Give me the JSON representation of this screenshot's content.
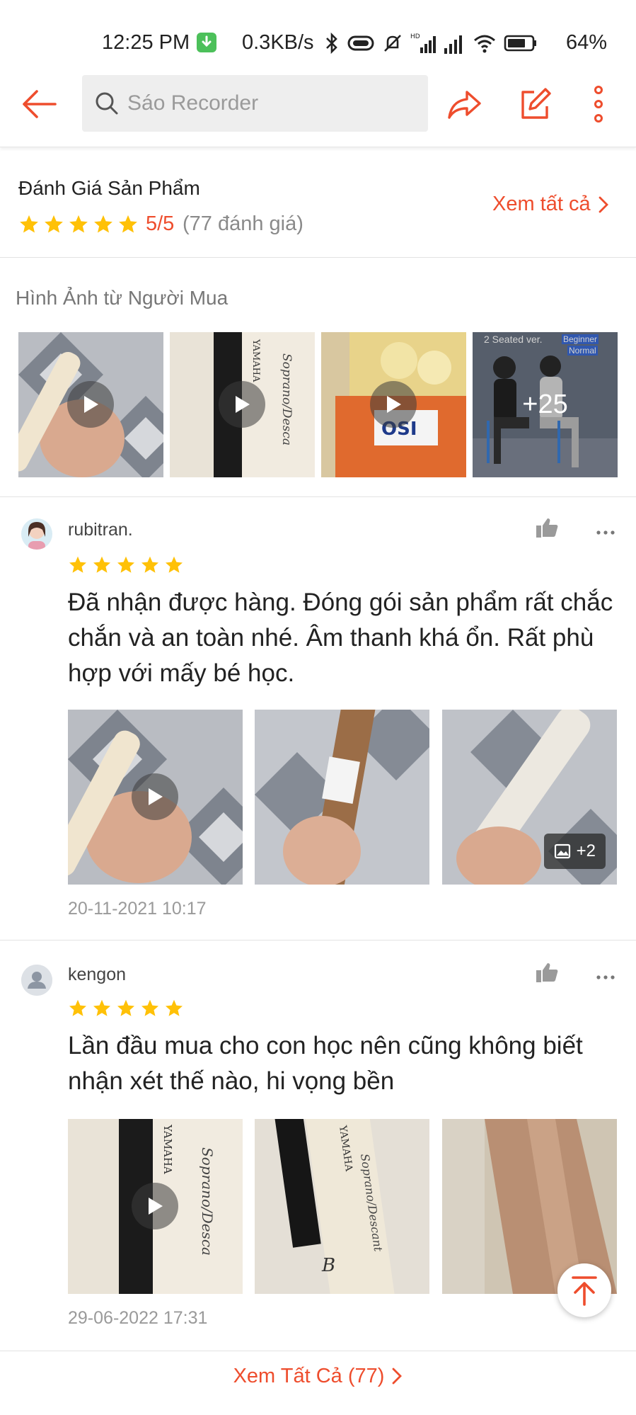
{
  "status_bar": {
    "time": "12:25 PM",
    "net_speed": "0.3KB/s",
    "battery": "64%"
  },
  "header": {
    "search_placeholder": "Sáo Recorder",
    "accent_color": "#ee4d2d"
  },
  "rating_summary": {
    "title": "Đánh Giá Sản Phẩm",
    "stars": 5,
    "score": "5/5",
    "count": "(77 đánh giá)",
    "view_all": "Xem tất cả"
  },
  "buyer_photos": {
    "title": "Hình Ảnh từ Người Mua",
    "thumbs": [
      {
        "type": "video"
      },
      {
        "type": "video"
      },
      {
        "type": "video"
      },
      {
        "type": "image",
        "overlay_text": "+25",
        "caption": "2 Seated ver.",
        "tag1": "Beginner",
        "tag2": "Normal"
      }
    ]
  },
  "reviews": [
    {
      "name": "rubitran.",
      "stars": 5,
      "text": "Đã nhận được hàng. Đóng gói sản phẩm rất chắc chắn và an toàn nhé. Âm thanh khá ổn. Rất phù hợp với mấy bé học.",
      "extra_media": "+2",
      "date": "20-11-2021 10:17"
    },
    {
      "name": "kengon",
      "stars": 5,
      "text": "Lần đầu mua cho con học nên cũng không biết nhận xét thế nào, hi vọng bền",
      "date": "29-06-2022 17:31"
    }
  ],
  "footer": {
    "view_all": "Xem Tất Cả (77)"
  }
}
